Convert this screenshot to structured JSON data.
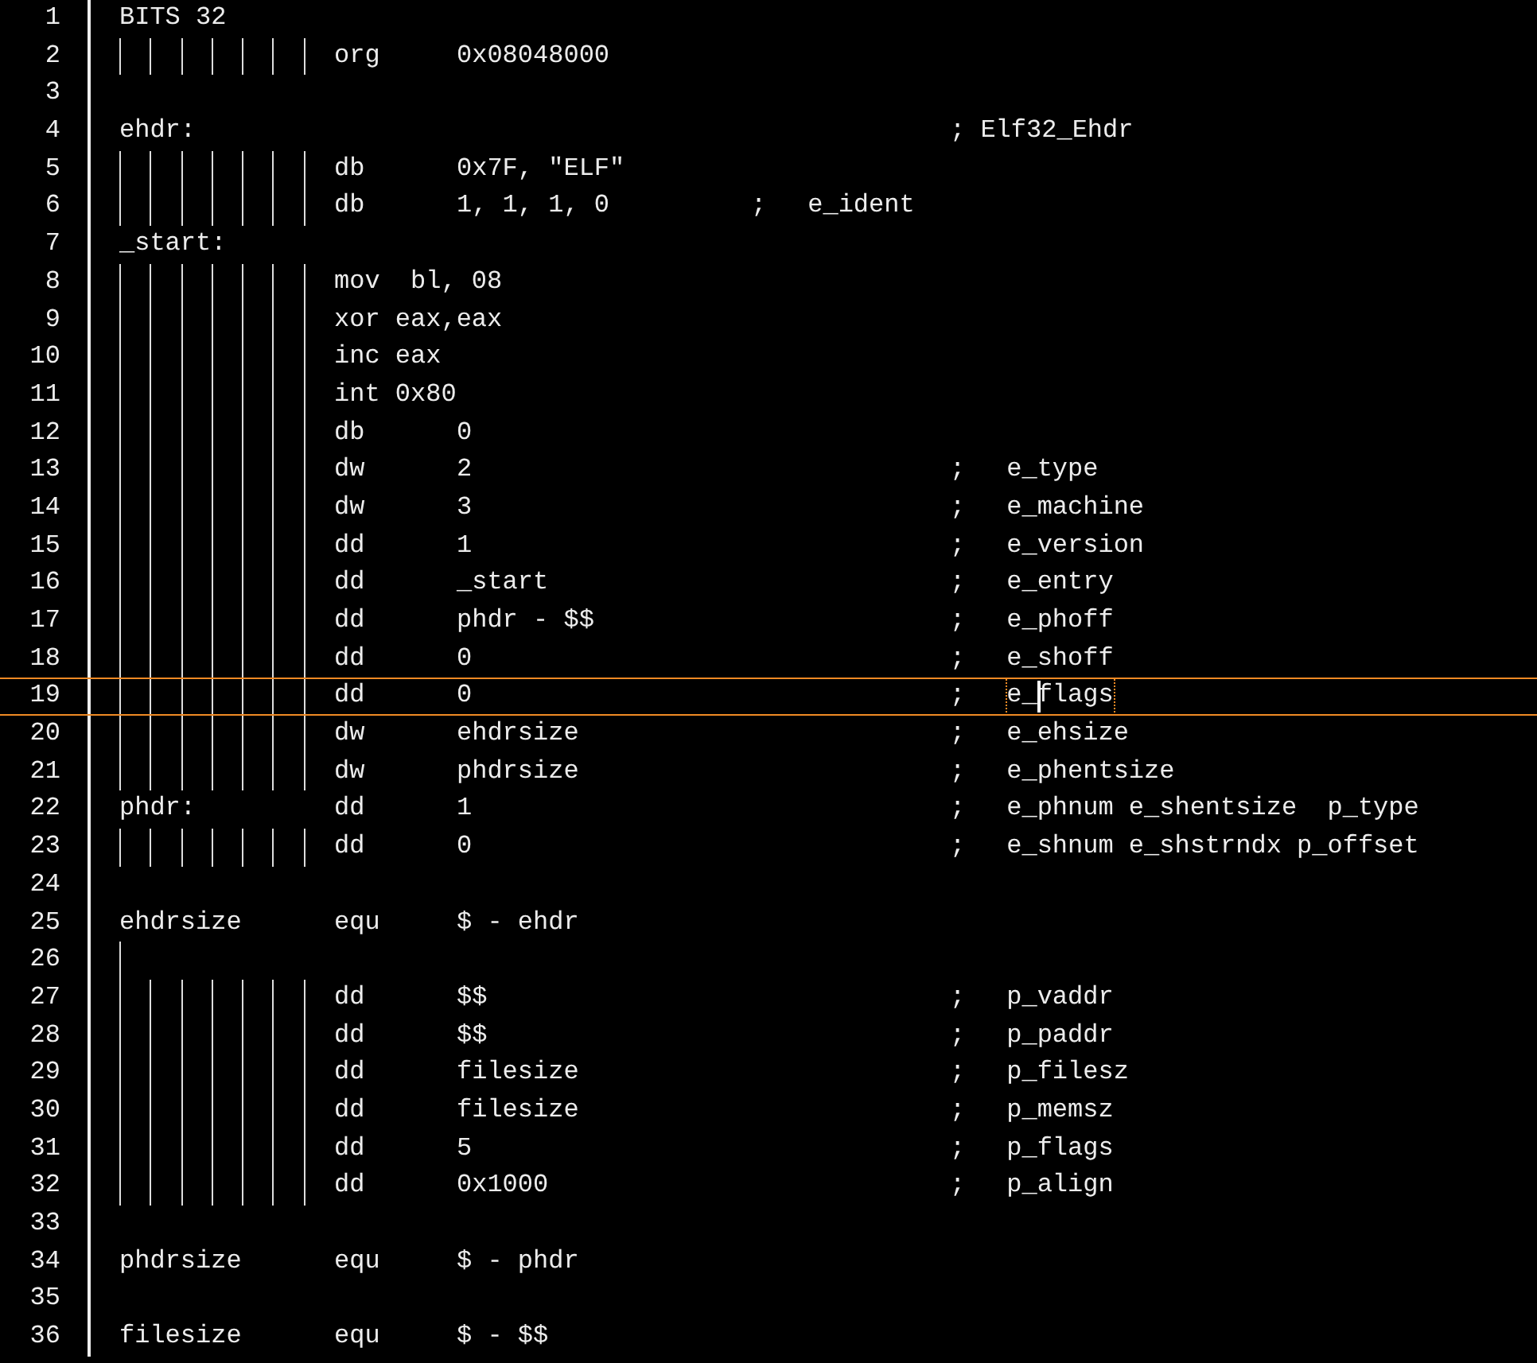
{
  "editor": {
    "lines": [
      {
        "number": "1",
        "kind": "label",
        "label": "BITS 32"
      },
      {
        "number": "2",
        "kind": "tabbed",
        "instr": "org",
        "operand": "0x08048000"
      },
      {
        "number": "3",
        "kind": "blank"
      },
      {
        "number": "4",
        "kind": "label",
        "label": "ehdr:",
        "comment": "; Elf32_Ehdr"
      },
      {
        "number": "5",
        "kind": "tabbed",
        "instr": "db",
        "operand": "0x7F, \"ELF\""
      },
      {
        "number": "6",
        "kind": "tabbed",
        "instr": "db",
        "operand": "1, 1, 1, 0",
        "comment_near": true,
        "comment_mark": ";",
        "comment": "e_ident"
      },
      {
        "number": "7",
        "kind": "label",
        "label": "_start:"
      },
      {
        "number": "8",
        "kind": "tabbed",
        "instr": "mov  bl, 08"
      },
      {
        "number": "9",
        "kind": "tabbed",
        "instr": "xor eax,eax"
      },
      {
        "number": "10",
        "kind": "tabbed",
        "instr": "inc eax"
      },
      {
        "number": "11",
        "kind": "tabbed",
        "instr": "int 0x80"
      },
      {
        "number": "12",
        "kind": "tabbed",
        "instr": "db",
        "operand": "0"
      },
      {
        "number": "13",
        "kind": "tabbed",
        "instr": "dw",
        "operand": "2",
        "comment_mark": ";",
        "comment": "e_type"
      },
      {
        "number": "14",
        "kind": "tabbed",
        "instr": "dw",
        "operand": "3",
        "comment_mark": ";",
        "comment": "e_machine"
      },
      {
        "number": "15",
        "kind": "tabbed",
        "instr": "dd",
        "operand": "1",
        "comment_mark": ";",
        "comment": "e_version"
      },
      {
        "number": "16",
        "kind": "tabbed",
        "instr": "dd",
        "operand": "_start",
        "comment_mark": ";",
        "comment": "e_entry"
      },
      {
        "number": "17",
        "kind": "tabbed",
        "instr": "dd",
        "operand": "phdr - $$",
        "comment_mark": ";",
        "comment": "e_phoff"
      },
      {
        "number": "18",
        "kind": "tabbed",
        "instr": "dd",
        "operand": "0",
        "comment_mark": ";",
        "comment": "e_shoff"
      },
      {
        "number": "19",
        "kind": "tabbed",
        "instr": "dd",
        "operand": "0",
        "comment_mark": ";",
        "comment": "e_flags",
        "current": true,
        "word_highlight": true,
        "cursor": true
      },
      {
        "number": "20",
        "kind": "tabbed",
        "instr": "dw",
        "operand": "ehdrsize",
        "comment_mark": ";",
        "comment": "e_ehsize"
      },
      {
        "number": "21",
        "kind": "tabbed",
        "instr": "dw",
        "operand": "phdrsize",
        "comment_mark": ";",
        "comment": "e_phentsize"
      },
      {
        "number": "22",
        "kind": "label",
        "label": "phdr:",
        "instr": "dd",
        "operand": "1",
        "comment_mark": ";",
        "comment": "e_phnum e_shentsize  p_type"
      },
      {
        "number": "23",
        "kind": "tabbed",
        "instr": "dd",
        "operand": "0",
        "comment_mark": ";",
        "comment": "e_shnum e_shstrndx p_offset"
      },
      {
        "number": "24",
        "kind": "blank"
      },
      {
        "number": "25",
        "kind": "label",
        "label": "ehdrsize",
        "instr": "equ",
        "operand": "$ - ehdr"
      },
      {
        "number": "26",
        "kind": "single-tab"
      },
      {
        "number": "27",
        "kind": "tabbed",
        "instr": "dd",
        "operand": "$$",
        "comment_mark": ";",
        "comment": "p_vaddr"
      },
      {
        "number": "28",
        "kind": "tabbed",
        "instr": "dd",
        "operand": "$$",
        "comment_mark": ";",
        "comment": "p_paddr"
      },
      {
        "number": "29",
        "kind": "tabbed",
        "instr": "dd",
        "operand": "filesize",
        "comment_mark": ";",
        "comment": "p_filesz"
      },
      {
        "number": "30",
        "kind": "tabbed",
        "instr": "dd",
        "operand": "filesize",
        "comment_mark": ";",
        "comment": "p_memsz"
      },
      {
        "number": "31",
        "kind": "tabbed",
        "instr": "dd",
        "operand": "5",
        "comment_mark": ";",
        "comment": "p_flags"
      },
      {
        "number": "32",
        "kind": "tabbed",
        "instr": "dd",
        "operand": "0x1000",
        "comment_mark": ";",
        "comment": "p_align"
      },
      {
        "number": "33",
        "kind": "blank"
      },
      {
        "number": "34",
        "kind": "label",
        "label": "phdrsize",
        "instr": "equ",
        "operand": "$ - phdr"
      },
      {
        "number": "35",
        "kind": "blank"
      },
      {
        "number": "36",
        "kind": "label",
        "label": "filesize",
        "instr": "equ",
        "operand": "$ - $$"
      }
    ]
  }
}
